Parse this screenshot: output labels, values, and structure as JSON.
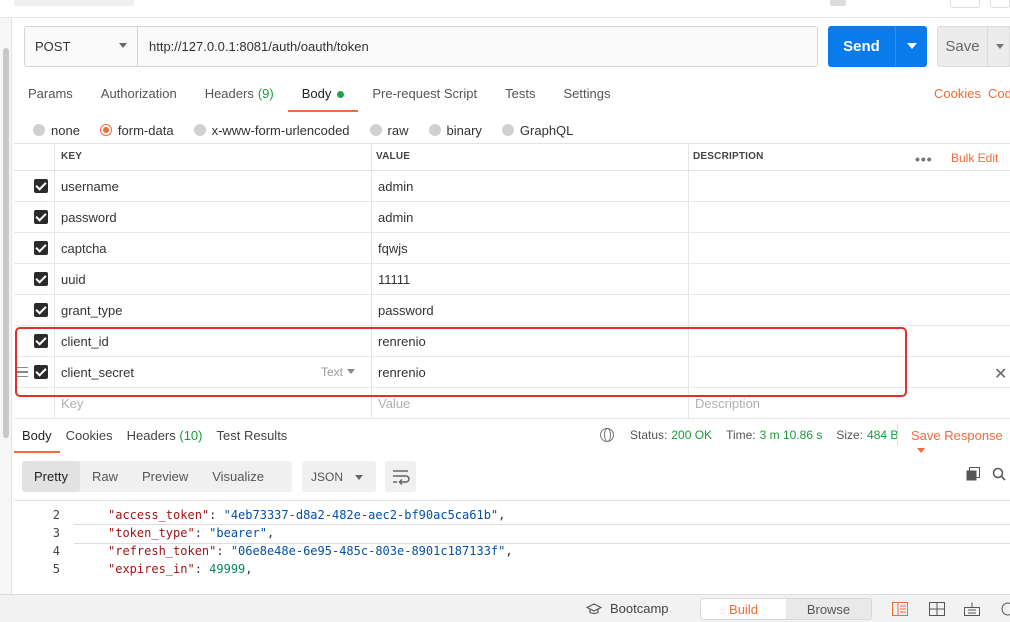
{
  "request": {
    "method": "POST",
    "url": "http://127.0.0.1:8081/auth/oauth/token",
    "send_label": "Send",
    "save_label": "Save"
  },
  "request_tabs": [
    {
      "label": "Params"
    },
    {
      "label": "Authorization"
    },
    {
      "label": "Headers",
      "count": "(9)"
    },
    {
      "label": "Body"
    },
    {
      "label": "Pre-request Script"
    },
    {
      "label": "Tests"
    },
    {
      "label": "Settings"
    }
  ],
  "links": {
    "cookies": "Cookies",
    "code": "Cod"
  },
  "body_types": [
    {
      "label": "none"
    },
    {
      "label": "form-data"
    },
    {
      "label": "x-www-form-urlencoded"
    },
    {
      "label": "raw"
    },
    {
      "label": "binary"
    },
    {
      "label": "GraphQL"
    }
  ],
  "table": {
    "headers": {
      "key": "KEY",
      "value": "VALUE",
      "description": "DESCRIPTION"
    },
    "more": "•••",
    "bulk_edit": "Bulk Edit",
    "rows": [
      {
        "key": "username",
        "value": "admin"
      },
      {
        "key": "password",
        "value": "admin"
      },
      {
        "key": "captcha",
        "value": "fqwjs"
      },
      {
        "key": "uuid",
        "value": "11111"
      },
      {
        "key": "grant_type",
        "value": "password"
      },
      {
        "key": "client_id",
        "value": "renrenio"
      },
      {
        "key": "client_secret",
        "value": "renrenio",
        "type": "Text"
      }
    ],
    "placeholders": {
      "key": "Key",
      "value": "Value",
      "description": "Description"
    }
  },
  "response": {
    "tabs": [
      {
        "label": "Body"
      },
      {
        "label": "Cookies"
      },
      {
        "label": "Headers",
        "count": "(10)"
      },
      {
        "label": "Test Results"
      }
    ],
    "status_label": "Status:",
    "status": "200 OK",
    "time_label": "Time:",
    "time": "3 m 10.86 s",
    "size_label": "Size:",
    "size": "484 B",
    "save_response": "Save Response",
    "views": [
      {
        "label": "Pretty"
      },
      {
        "label": "Raw"
      },
      {
        "label": "Preview"
      },
      {
        "label": "Visualize"
      }
    ],
    "format": "JSON",
    "code_lines": [
      {
        "ln": "2",
        "key": "\"access_token\"",
        "sep": ": ",
        "val": "\"4eb73337-d8a2-482e-aec2-bf90ac5ca61b\"",
        "end": ",",
        "val_type": "s"
      },
      {
        "ln": "3",
        "key": "\"token_type\"",
        "sep": ": ",
        "val": "\"bearer\"",
        "end": ",",
        "val_type": "s"
      },
      {
        "ln": "4",
        "key": "\"refresh_token\"",
        "sep": ": ",
        "val": "\"06e8e48e-6e95-485c-803e-8901c187133f\"",
        "end": ",",
        "val_type": "s"
      },
      {
        "ln": "5",
        "key": "\"expires_in\"",
        "sep": ": ",
        "val": "49999",
        "end": ",",
        "val_type": "n"
      }
    ]
  },
  "footer": {
    "bootcamp": "Bootcamp",
    "build": "Build",
    "browse": "Browse"
  },
  "colors": {
    "accent": "#f26b3a",
    "primary": "#097bed",
    "success": "#1b9a3a",
    "highlight": "#e0302b"
  }
}
